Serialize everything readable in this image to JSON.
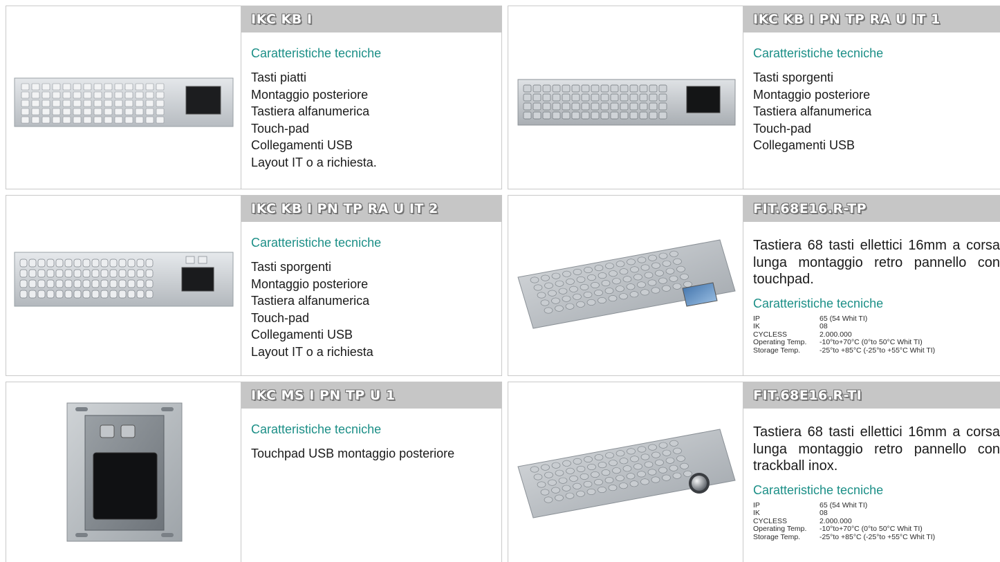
{
  "products": [
    {
      "title": "IKC KB I",
      "subheading": "Caratteristiche tecniche",
      "features": [
        "Tasti piatti",
        "Montaggio posteriore",
        "Tastiera alfanumerica",
        "Touch-pad",
        "Collegamenti USB",
        "Layout IT o a richiesta."
      ],
      "image": "keyboard-flat-keys-touchpad"
    },
    {
      "title": "IKC KB I PN TP RA U IT 1",
      "subheading": "Caratteristiche tecniche",
      "features": [
        "Tasti sporgenti",
        "Montaggio posteriore",
        "Tastiera alfanumerica",
        "Touch-pad",
        "Collegamenti USB"
      ],
      "image": "keyboard-raised-keys-touchpad"
    },
    {
      "title": "IKC KB I PN TP RA U IT 2",
      "subheading": "Caratteristiche tecniche",
      "features": [
        "Tasti sporgenti",
        "Montaggio posteriore",
        "Tastiera alfanumerica",
        "Touch-pad",
        "Collegamenti USB",
        "Layout IT o a richiesta"
      ],
      "image": "keyboard-raised-keys-touchpad"
    },
    {
      "title": "FIT.68E16.R-TP",
      "description": "Tastiera 68 tasti ellettici 16mm a corsa lunga montaggio retro pannello con touchpad.",
      "subheading": "Caratteristiche tecniche",
      "specs": [
        {
          "label": "IP",
          "value": "65 (54 Whit TI)"
        },
        {
          "label": "IK",
          "value": "08"
        },
        {
          "label": "CYCLESS",
          "value": "2.000.000"
        },
        {
          "label": "Operating Temp.",
          "value": "-10°to+70°C (0°to 50°C Whit TI)"
        },
        {
          "label": "Storage Temp.",
          "value": "-25°to +85°C (-25°to +55°C Whit TI)"
        }
      ],
      "image": "keyboard-elliptic-keys-touchpad"
    },
    {
      "title": "IKC MS I PN TP U 1",
      "subheading": "Caratteristiche tecniche",
      "features": [
        "Touchpad USB montaggio posteriore"
      ],
      "image": "touchpad-module"
    },
    {
      "title": "FIT.68E16.R-TI",
      "description": "Tastiera 68 tasti ellettici 16mm a corsa lunga montaggio retro pannello con trackball inox.",
      "subheading": "Caratteristiche tecniche",
      "specs": [
        {
          "label": "IP",
          "value": "65 (54 Whit TI)"
        },
        {
          "label": "IK",
          "value": "08"
        },
        {
          "label": "CYCLESS",
          "value": "2.000.000"
        },
        {
          "label": "Operating Temp.",
          "value": "-10°to+70°C (0°to 50°C Whit TI)"
        },
        {
          "label": "Storage Temp.",
          "value": "-25°to +85°C (-25°to +55°C Whit TI)"
        }
      ],
      "image": "keyboard-elliptic-keys-trackball"
    }
  ],
  "colors": {
    "title_bar": "#c6c6c6",
    "subheading": "#1c8f87",
    "border": "#c9c9c9",
    "steel": "#c4c8cc"
  }
}
